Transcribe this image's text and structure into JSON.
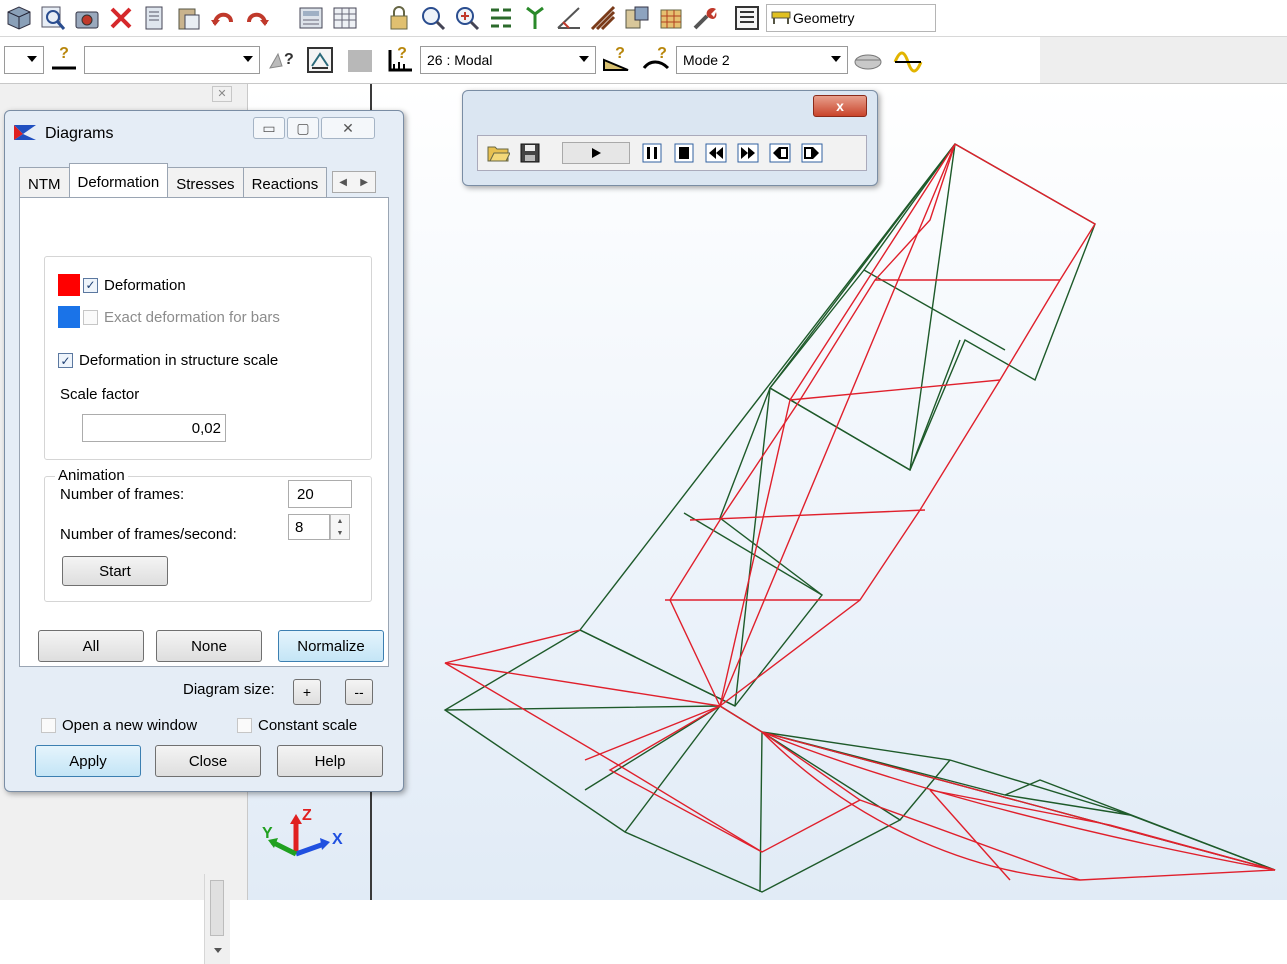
{
  "toolbar1": {
    "icons": [
      "structure-model-icon",
      "zoom-icon",
      "camera-icon",
      "delete-icon",
      "copy-icon",
      "paste-icon",
      "undo-icon",
      "redo-icon",
      "calculator-icon",
      "table-icon",
      "lock-icon",
      "zoom-window-icon",
      "zoom-region-icon",
      "nodes-icon",
      "supports-icon",
      "measure-icon",
      "bars-icon",
      "layout-icon",
      "3d-view-icon",
      "tools-icon",
      "list-icon"
    ],
    "layout_label": "Geometry"
  },
  "toolbar2": {
    "case_value": "26 : Modal",
    "mode_value": "Mode  2"
  },
  "diagrams": {
    "title": "Diagrams",
    "tabs": [
      "NTM",
      "Deformation",
      "Stresses",
      "Reactions"
    ],
    "active_tab": "Deformation",
    "deformation_label": "Deformation",
    "exact_label": "Exact deformation for bars",
    "structure_scale_label": "Deformation in structure scale",
    "scale_factor_label": "Scale factor",
    "scale_factor_value": "0,02",
    "animation_label": "Animation",
    "frames_label": "Number of frames:",
    "frames_value": "20",
    "fps_label": "Number of frames/second:",
    "fps_value": "8",
    "start_label": "Start",
    "all_label": "All",
    "none_label": "None",
    "normalize_label": "Normalize",
    "diagram_size_label": "Diagram size:",
    "plus_label": "+",
    "minus_label": "--",
    "open_window_label": "Open a new window",
    "constant_scale_label": "Constant scale",
    "apply_label": "Apply",
    "close_label": "Close",
    "help_label": "Help"
  },
  "animation_window": {
    "close_label": "x"
  },
  "axes": {
    "x": "X",
    "y": "Y",
    "z": "Z"
  },
  "colors": {
    "deformation": "#ff0000",
    "exact_deformation": "#1a73e8",
    "structure": "#1e5a2a",
    "deformed": "#e0202c"
  }
}
